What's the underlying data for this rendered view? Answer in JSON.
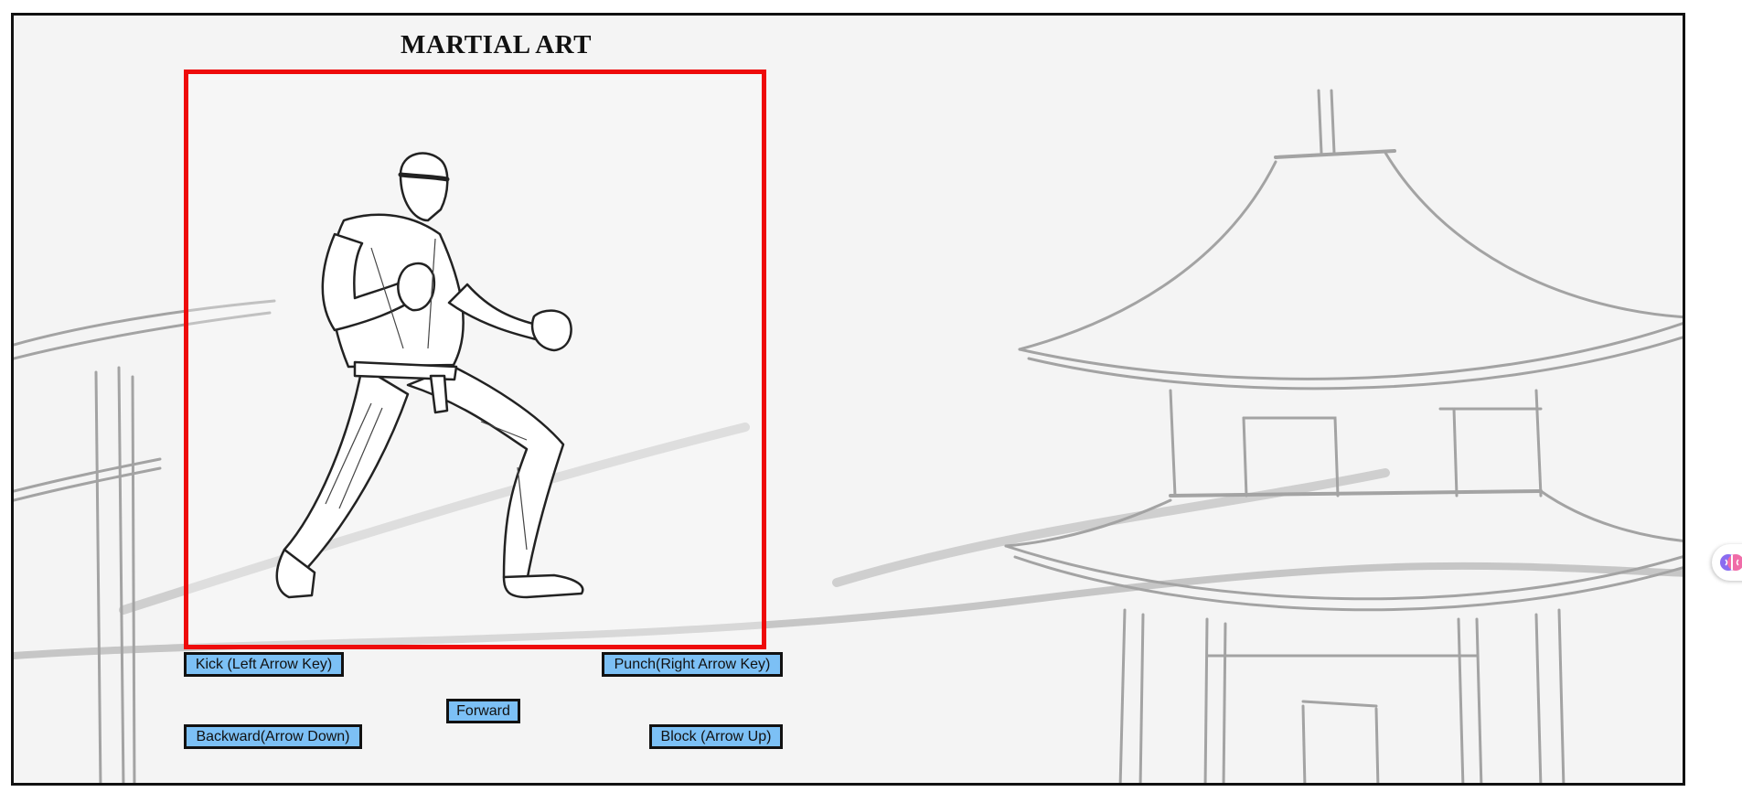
{
  "page": {
    "title": "MARTIAL ART"
  },
  "controls": {
    "kick": "Kick (Left Arrow Key)",
    "punch": "Punch(Right Arrow Key)",
    "forward": "Forward",
    "backward": "Backward(Arrow Down)",
    "block": "Block (Arrow Up)"
  },
  "colors": {
    "frame_border": "#ee0b0b",
    "button_fill": "#7cc0f5",
    "button_border": "#111111",
    "sketch_stroke": "#9a9a9a"
  },
  "icons": {
    "extension": "brain-icon"
  }
}
